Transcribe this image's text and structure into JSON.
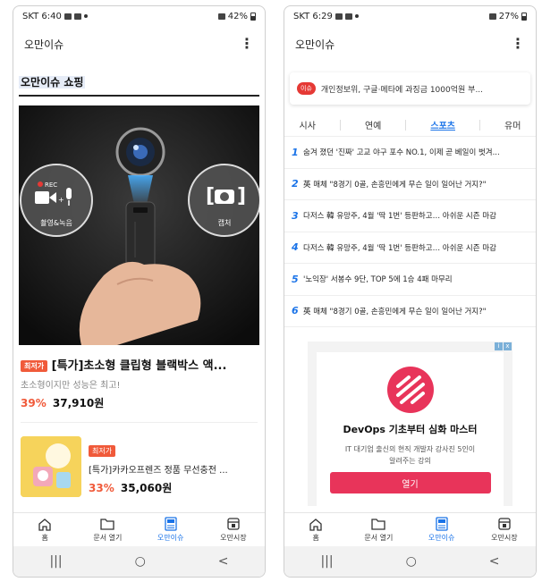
{
  "left": {
    "status": {
      "carrier_time": "SKT 6:40",
      "battery": "42%"
    },
    "app_title": "오만이슈",
    "section_title": "오만이슈 쇼핑",
    "image_texts": {
      "rec": "REC",
      "record_label": "촬영&녹음",
      "capture_label": "캡처"
    },
    "product1": {
      "badge": "최저가",
      "title": "[특가]초소형 클립형 블랙박스 액...",
      "subtitle": "초소형이지만 성능은 최고!",
      "discount": "39%",
      "price": "37,910원"
    },
    "product2": {
      "badge": "최저가",
      "title": "[특가]카카오프렌즈 정품 무선충전 ...",
      "discount": "33%",
      "price": "35,060원"
    }
  },
  "right": {
    "status": {
      "carrier_time": "SKT 6:29",
      "battery": "27%"
    },
    "app_title": "오만이슈",
    "issue_banner": {
      "pill": "이슈",
      "text": "개인정보위, 구글·메타에 과징금 1000억원 부..."
    },
    "tabs": [
      {
        "label": "시사"
      },
      {
        "label": "연예"
      },
      {
        "label": "스포츠"
      },
      {
        "label": "유머"
      }
    ],
    "news": [
      {
        "num": "1",
        "text": "숨겨 졌던 '진짜' 고교 야구 포수 NO.1, 이제 곧 베일이 벗겨..."
      },
      {
        "num": "2",
        "text": "英 매체 \"8경기 0골, 손흥민에게 무슨 일이 일어난 거지?\""
      },
      {
        "num": "3",
        "text": "다저스 韓 유망주, 4월 '딱 1번' 등판하고… 아쉬운 시즌 마감"
      },
      {
        "num": "4",
        "text": "다저스 韓 유망주, 4월 '딱 1번' 등판하고… 아쉬운 시즌 마감"
      },
      {
        "num": "5",
        "text": "'노익장' 서봉수 9단, TOP 5에 1승 4패 마무리"
      },
      {
        "num": "6",
        "text": "英 매체 \"8경기 0골, 손흥민에게 무슨 일이 일어난 거지?\""
      }
    ],
    "ad": {
      "title": "DevOps 기초부터 심화 마스터",
      "desc": "IT 대기업 출신의 현직 개발자 강사진 5인이 알려주는 강의",
      "cta": "열기",
      "close_labels": [
        "i",
        "x"
      ]
    }
  },
  "bottom_nav": [
    {
      "label": "홈",
      "icon": "home-icon"
    },
    {
      "label": "문서 열기",
      "icon": "folder-icon"
    },
    {
      "label": "오만이슈",
      "icon": "news-icon"
    },
    {
      "label": "오만시장",
      "icon": "store-icon"
    }
  ],
  "system_nav": {
    "recents": "|||",
    "home": "○",
    "back": "<"
  },
  "colors": {
    "accent": "#1a73e8",
    "badge": "#f05a3a",
    "ad_cta": "#e8345a",
    "issue": "#e53935"
  }
}
